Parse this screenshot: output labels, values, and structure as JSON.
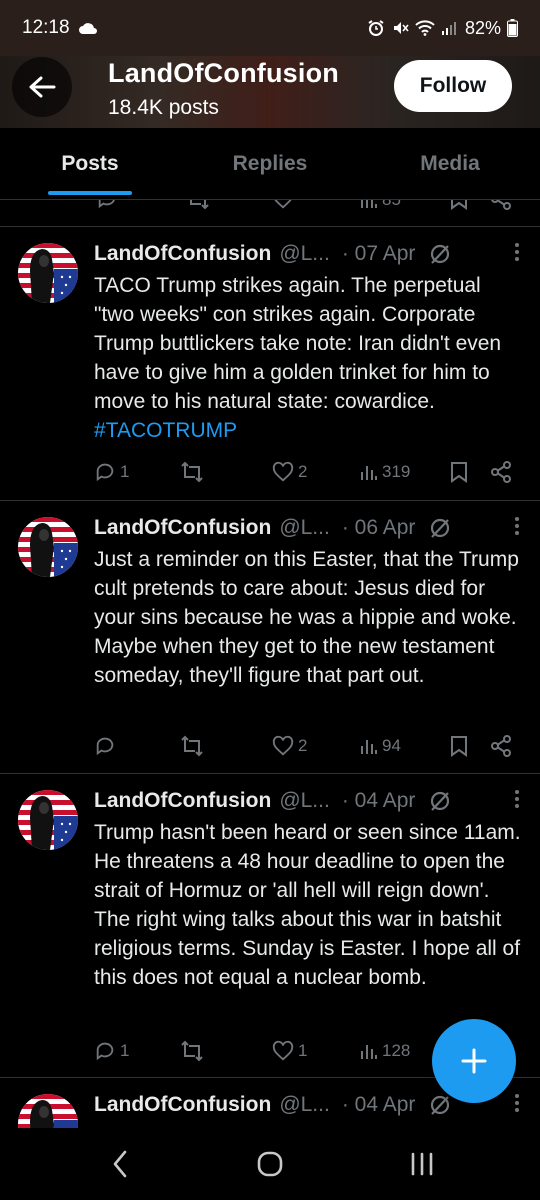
{
  "status_bar": {
    "time": "12:18",
    "battery": "82%"
  },
  "header": {
    "title": "LandOfConfusion",
    "subtitle": "18.4K posts",
    "follow_label": "Follow"
  },
  "tabs": [
    {
      "label": "Posts",
      "active": true
    },
    {
      "label": "Replies",
      "active": false
    },
    {
      "label": "Media",
      "active": false
    }
  ],
  "previous_tweet": {
    "views": "85"
  },
  "tweets": [
    {
      "name": "LandOfConfusion",
      "handle": "@L...",
      "date": "· 07 Apr",
      "text": "TACO Trump strikes again. The perpetual \"two weeks\" con strikes again. Corporate Trump buttlickers take note: Iran didn't even have to give him a golden trinket for him to move to his natural state: cowardice.",
      "hashtag": "#TACOTRUMP",
      "replies": "1",
      "reposts": "",
      "likes": "2",
      "views": "319"
    },
    {
      "name": "LandOfConfusion",
      "handle": "@L...",
      "date": "· 06 Apr",
      "text": "Just a reminder on this Easter, that the Trump cult pretends to care about: Jesus died for your sins because he was a hippie and woke. Maybe when they get to the new testament someday, they'll figure that part out.",
      "hashtag": "",
      "replies": "",
      "reposts": "",
      "likes": "2",
      "views": "94"
    },
    {
      "name": "LandOfConfusion",
      "handle": "@L...",
      "date": "· 04 Apr",
      "text": "Trump hasn't been heard or seen since 11am. He threatens a 48 hour deadline to open the strait of Hormuz or 'all hell will reign down'. The right wing talks about this war in batshit religious terms. Sunday is Easter. I hope all of this does not equal a nuclear bomb.",
      "hashtag": "",
      "replies": "1",
      "reposts": "",
      "likes": "1",
      "views": "128"
    },
    {
      "name": "LandOfConfusion",
      "handle": "@L...",
      "date": "· 04 Apr",
      "text": "",
      "hashtag": "",
      "replies": "",
      "reposts": "",
      "likes": "",
      "views": ""
    }
  ],
  "icons": {
    "back": "arrow-left-icon",
    "reply": "reply-icon",
    "repost": "repost-icon",
    "like": "heart-icon",
    "views": "views-icon",
    "bookmark": "bookmark-icon",
    "share": "share-icon",
    "grok": "grok-icon",
    "more": "more-dots-icon",
    "compose": "plus-icon"
  },
  "colors": {
    "accent": "#1d9bf0",
    "background": "#000000",
    "text": "#e7e9ea",
    "muted": "#71767b"
  }
}
